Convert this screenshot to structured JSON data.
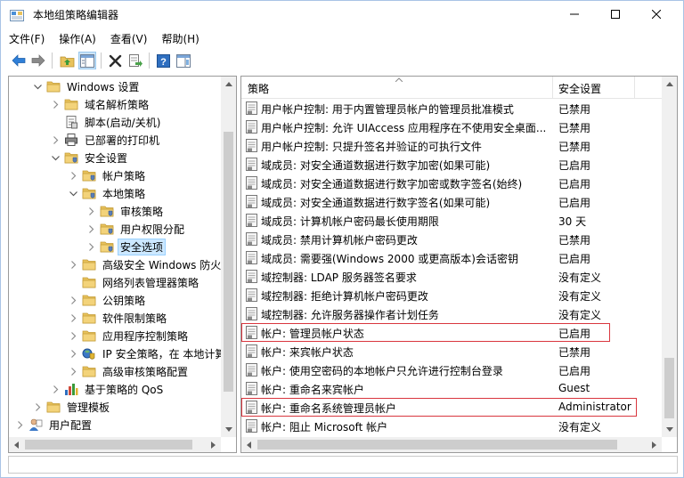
{
  "window": {
    "title": "本地组策略编辑器",
    "controls": [
      "minimize",
      "maximize",
      "close"
    ]
  },
  "menu": {
    "file": "文件(F)",
    "action": "操作(A)",
    "view": "查看(V)",
    "help": "帮助(H)"
  },
  "toolbar": {
    "icons": [
      "back-arrow-icon",
      "forward-arrow-icon",
      "up-folder-icon",
      "show-hide-tree-icon",
      "delete-icon",
      "export-list-icon",
      "help-icon",
      "properties-view-icon"
    ]
  },
  "tree": {
    "items": [
      {
        "label": "Windows 设置",
        "icon": "folder-icon",
        "expanded": true
      },
      {
        "label": "域名解析策略",
        "icon": "folder-icon"
      },
      {
        "label": "脚本(启动/关机)",
        "icon": "script-icon"
      },
      {
        "label": "已部署的打印机",
        "icon": "printer-icon"
      },
      {
        "label": "安全设置",
        "icon": "security-folder-icon",
        "expanded": true
      },
      {
        "label": "帐户策略",
        "icon": "security-folder-icon"
      },
      {
        "label": "本地策略",
        "icon": "security-folder-icon",
        "expanded": true
      },
      {
        "label": "审核策略",
        "icon": "security-folder-icon"
      },
      {
        "label": "用户权限分配",
        "icon": "security-folder-icon"
      },
      {
        "label": "安全选项",
        "icon": "security-folder-icon",
        "selected": true
      },
      {
        "label": "高级安全 Windows 防火墙",
        "icon": "folder-icon"
      },
      {
        "label": "网络列表管理器策略",
        "icon": "folder-icon"
      },
      {
        "label": "公钥策略",
        "icon": "folder-icon"
      },
      {
        "label": "软件限制策略",
        "icon": "folder-icon"
      },
      {
        "label": "应用程序控制策略",
        "icon": "folder-icon"
      },
      {
        "label": "IP 安全策略，在 本地计算机",
        "icon": "ip-security-icon"
      },
      {
        "label": "高级审核策略配置",
        "icon": "folder-icon"
      },
      {
        "label": "基于策略的 QoS",
        "icon": "qos-chart-icon"
      },
      {
        "label": "管理模板",
        "icon": "folder-icon"
      },
      {
        "label": "用户配置",
        "icon": "user-config-icon"
      }
    ]
  },
  "list": {
    "columns": {
      "policy": "策略",
      "setting": "安全设置"
    },
    "rows": [
      {
        "policy": "用户帐户控制: 用于内置管理员帐户的管理员批准模式",
        "setting": "已禁用"
      },
      {
        "policy": "用户帐户控制: 允许 UIAccess 应用程序在不使用安全桌面...",
        "setting": "已禁用"
      },
      {
        "policy": "用户帐户控制: 只提升签名并验证的可执行文件",
        "setting": "已禁用"
      },
      {
        "policy": "域成员: 对安全通道数据进行数字加密(如果可能)",
        "setting": "已启用"
      },
      {
        "policy": "域成员: 对安全通道数据进行数字加密或数字签名(始终)",
        "setting": "已启用"
      },
      {
        "policy": "域成员: 对安全通道数据进行数字签名(如果可能)",
        "setting": "已启用"
      },
      {
        "policy": "域成员: 计算机帐户密码最长使用期限",
        "setting": "30 天"
      },
      {
        "policy": "域成员: 禁用计算机帐户密码更改",
        "setting": "已禁用"
      },
      {
        "policy": "域成员: 需要强(Windows 2000 或更高版本)会话密钥",
        "setting": "已启用"
      },
      {
        "policy": "域控制器: LDAP 服务器签名要求",
        "setting": "没有定义"
      },
      {
        "policy": "域控制器: 拒绝计算机帐户密码更改",
        "setting": "没有定义"
      },
      {
        "policy": "域控制器: 允许服务器操作者计划任务",
        "setting": "没有定义"
      },
      {
        "policy": "帐户: 管理员帐户状态",
        "setting": "已启用",
        "highlighted": true
      },
      {
        "policy": "帐户: 来宾帐户状态",
        "setting": "已禁用"
      },
      {
        "policy": "帐户: 使用空密码的本地帐户只允许进行控制台登录",
        "setting": "已启用"
      },
      {
        "policy": "帐户: 重命名来宾帐户",
        "setting": "Guest"
      },
      {
        "policy": "帐户: 重命名系统管理员帐户",
        "setting": "Administrator",
        "highlighted": true
      },
      {
        "policy": "帐户: 阻止 Microsoft 帐户",
        "setting": "没有定义"
      }
    ]
  },
  "colors": {
    "highlight_border": "#d9363e",
    "selection_bg": "#cce8ff",
    "folder": "#e8c25c"
  }
}
